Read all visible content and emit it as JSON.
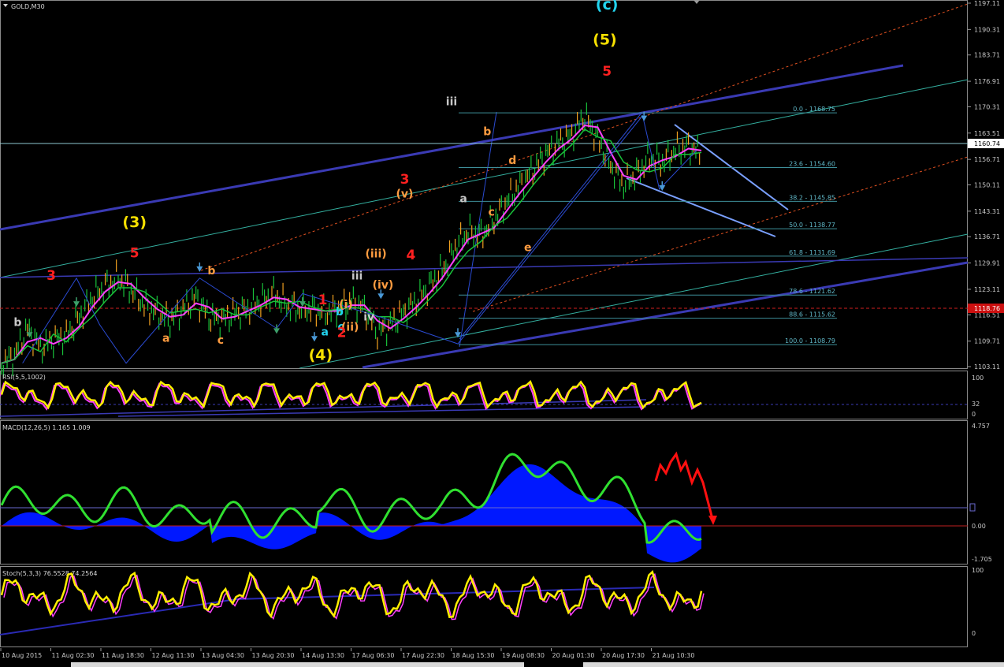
{
  "header": {
    "symbol_label": "GOLD,M30"
  },
  "price_axis": {
    "ticks": [
      "1197.11",
      "1190.31",
      "1183.71",
      "1176.91",
      "1170.31",
      "1163.51",
      "1156.71",
      "1150.11",
      "1143.31",
      "1136.71",
      "1129.91",
      "1123.11",
      "1116.51",
      "1109.71",
      "1103.11"
    ],
    "ylim": [
      1103.11,
      1197.11
    ],
    "current_price": "1160.74",
    "red_marker_label": "1118.76"
  },
  "time_axis": {
    "labels": [
      "10 Aug 2015",
      "11 Aug 02:30",
      "11 Aug 18:30",
      "12 Aug 11:30",
      "13 Aug 04:30",
      "13 Aug 20:30",
      "14 Aug 13:30",
      "17 Aug 06:30",
      "17 Aug 22:30",
      "18 Aug 15:30",
      "19 Aug 08:30",
      "20 Aug 01:30",
      "20 Aug 17:30",
      "21 Aug 10:30"
    ]
  },
  "fibonacci": {
    "levels": [
      "0.0 - 1168.75",
      "23.6 - 1154.60",
      "38.2 - 1145.85",
      "50.0 - 1138.77",
      "61.8 - 1131.69",
      "78.6 - 1121.62",
      "88.6 - 1115.62",
      "100.0 - 1108.79"
    ],
    "values": [
      1168.75,
      1154.6,
      1145.85,
      1138.77,
      1131.69,
      1121.62,
      1115.62,
      1108.79
    ]
  },
  "wave_labels": [
    {
      "text": "(c)",
      "color": "#22d3ee",
      "price": 1195.5,
      "t": 0.865
    },
    {
      "text": "(5)",
      "color": "#f7e000",
      "price": 1186.4,
      "t": 0.862
    },
    {
      "text": "5",
      "color": "#ff2020",
      "price": 1178.4,
      "t": 0.865
    },
    {
      "text": "iii",
      "color": "#c8c8c8",
      "price": 1170.7,
      "t": 0.643
    },
    {
      "text": "b",
      "color": "#ff9c40",
      "price": 1163.0,
      "t": 0.694
    },
    {
      "text": "d",
      "color": "#ff9c40",
      "price": 1155.5,
      "t": 0.73
    },
    {
      "text": "3",
      "color": "#ff2020",
      "price": 1150.4,
      "t": 0.576
    },
    {
      "text": "(v)",
      "color": "#ff9c40",
      "price": 1146.8,
      "t": 0.576
    },
    {
      "text": "a",
      "color": "#c8c8c8",
      "price": 1145.6,
      "t": 0.66
    },
    {
      "text": "c",
      "color": "#ff9c40",
      "price": 1142.2,
      "t": 0.7
    },
    {
      "text": "(3)",
      "color": "#f7e000",
      "price": 1139.2,
      "t": 0.19
    },
    {
      "text": "e",
      "color": "#ff9c40",
      "price": 1133.0,
      "t": 0.752
    },
    {
      "text": "5",
      "color": "#ff2020",
      "price": 1131.4,
      "t": 0.19
    },
    {
      "text": "(iii)",
      "color": "#ff9c40",
      "price": 1131.3,
      "t": 0.535
    },
    {
      "text": "4",
      "color": "#ff2020",
      "price": 1130.8,
      "t": 0.585
    },
    {
      "text": "3",
      "color": "#ff2020",
      "price": 1125.5,
      "t": 0.071
    },
    {
      "text": "b",
      "color": "#ff9c40",
      "price": 1127.0,
      "t": 0.3
    },
    {
      "text": "iii",
      "color": "#c8c8c8",
      "price": 1125.6,
      "t": 0.508
    },
    {
      "text": "(iv)",
      "color": "#ff9c40",
      "price": 1123.3,
      "t": 0.545
    },
    {
      "text": "1",
      "color": "#ff2020",
      "price": 1119.2,
      "t": 0.459
    },
    {
      "text": "(i)",
      "color": "#ff9c40",
      "price": 1118.2,
      "t": 0.492
    },
    {
      "text": "b",
      "color": "#22d3ee",
      "price": 1116.4,
      "t": 0.483
    },
    {
      "text": "iv",
      "color": "#c8c8c8",
      "price": 1115.0,
      "t": 0.525
    },
    {
      "text": "b",
      "color": "#c8c8c8",
      "price": 1113.6,
      "t": 0.023
    },
    {
      "text": "c",
      "color": "#22d3ee",
      "price": 1112.5,
      "t": 0.485
    },
    {
      "text": "(ii)",
      "color": "#ff9c40",
      "price": 1112.4,
      "t": 0.498
    },
    {
      "text": "a",
      "color": "#22d3ee",
      "price": 1111.2,
      "t": 0.462
    },
    {
      "text": "2",
      "color": "#ff2020",
      "price": 1110.8,
      "t": 0.486
    },
    {
      "text": "a",
      "color": "#ff9c40",
      "price": 1109.5,
      "t": 0.235
    },
    {
      "text": "c",
      "color": "#ff9c40",
      "price": 1109.0,
      "t": 0.313
    },
    {
      "text": "(4)",
      "color": "#f7e000",
      "price": 1104.8,
      "t": 0.456
    }
  ],
  "rsi": {
    "label": "RSI(5,5,1002)",
    "ticks": [
      "100",
      "32",
      "0"
    ]
  },
  "macd": {
    "label": "MACD(12,26,5) 1.165 1.009",
    "ticks": [
      "4.757",
      "0.00",
      "-1.705"
    ]
  },
  "stoch": {
    "label": "Stoch(5,3,3) 76.5528 74.2564",
    "ticks": [
      "100",
      "0"
    ]
  },
  "colors": {
    "background": "#000000",
    "bull": "#18c23a",
    "bear": "#f0a020",
    "ma_fast": "#ff40ff",
    "ma_slow": "#f7e000",
    "channel": "#3a3ab4",
    "fibo": "#5fb6c6",
    "forecast": "#7aa0ff",
    "rsi": "#ffee00",
    "macd_hist": "#0018ff",
    "macd_signal": "#30e030",
    "projection": "#ff1010"
  },
  "chart_data": {
    "type": "line",
    "title": "GOLD,M30",
    "xlabel": "",
    "ylabel": "",
    "ylim": [
      1103.11,
      1197.11
    ],
    "x": [
      "10 Aug 2015",
      "11 Aug 02:30",
      "11 Aug 18:30",
      "12 Aug 11:30",
      "13 Aug 04:30",
      "13 Aug 20:30",
      "14 Aug 13:30",
      "17 Aug 06:30",
      "17 Aug 22:30",
      "18 Aug 15:30",
      "19 Aug 08:30",
      "20 Aug 01:30",
      "20 Aug 17:30",
      "21 Aug 10:30"
    ],
    "series": [
      {
        "name": "GOLD,M30",
        "values": [
          1105.5,
          1116.0,
          1112.0,
          1124.0,
          1117.0,
          1115.5,
          1118.0,
          1119.5,
          1118.5,
          1116.0,
          1126.0,
          1141.0,
          1158.0,
          1158.5
        ]
      }
    ],
    "price_path": [
      1104,
      1106,
      1113,
      1108,
      1110,
      1111,
      1116,
      1121,
      1124,
      1126,
      1123,
      1119,
      1117,
      1115,
      1118,
      1121,
      1116,
      1115,
      1117,
      1118,
      1120,
      1122,
      1119,
      1118,
      1118,
      1117,
      1118,
      1120,
      1118,
      1112,
      1114,
      1117,
      1120,
      1124,
      1128,
      1134,
      1138,
      1137,
      1141,
      1146,
      1150,
      1154,
      1158,
      1161,
      1163,
      1168,
      1162,
      1155,
      1150,
      1153,
      1157,
      1156,
      1159,
      1160,
      1158
    ]
  }
}
